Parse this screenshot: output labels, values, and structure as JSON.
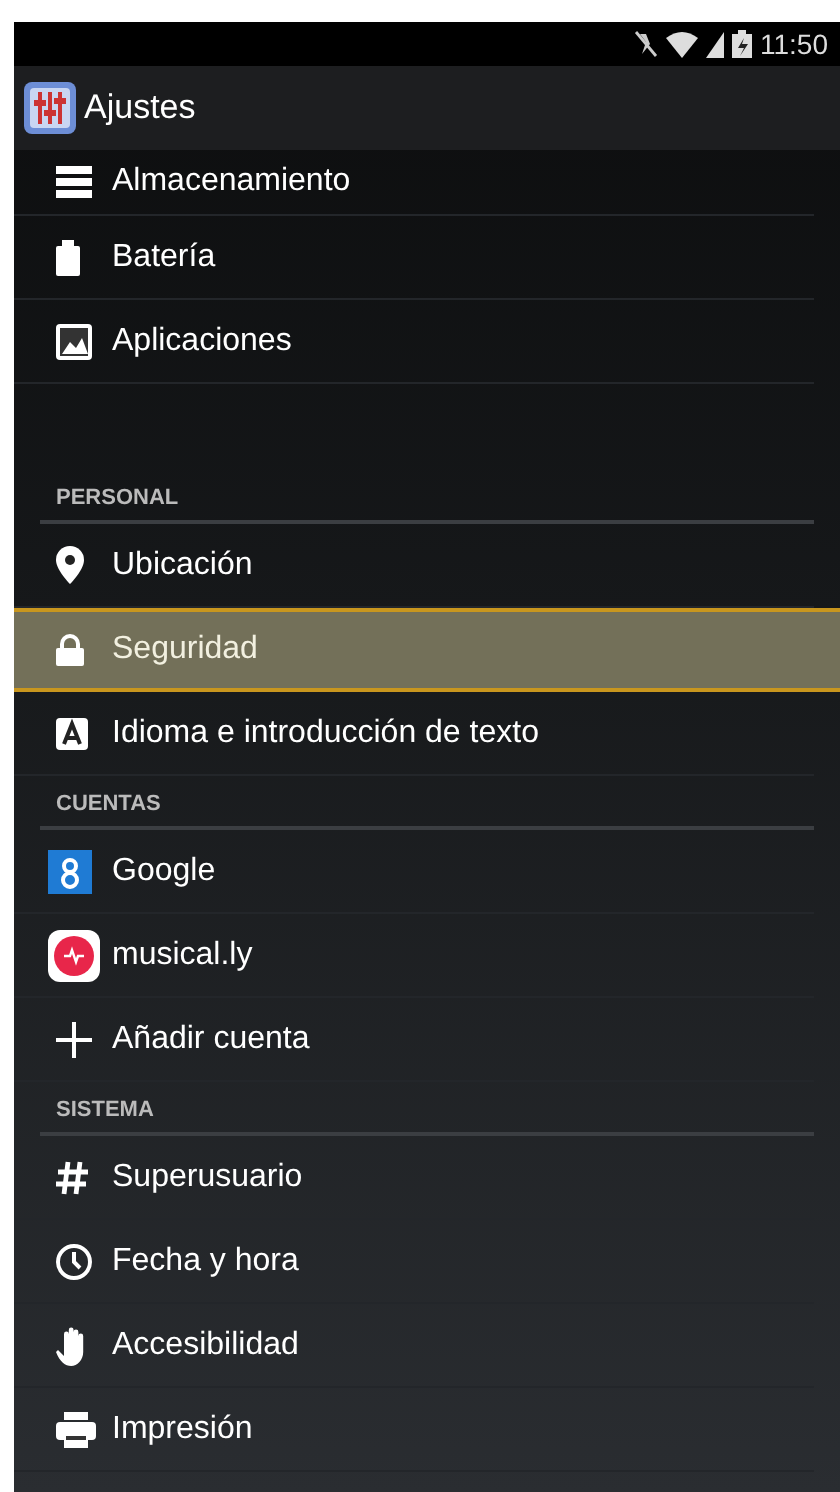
{
  "status_bar": {
    "time": "11:50"
  },
  "action_bar": {
    "title": "Ajustes"
  },
  "list": [
    {
      "kind": "item",
      "label": "Almacenamiento",
      "selected": false,
      "partial": true
    },
    {
      "kind": "item",
      "label": "Batería",
      "selected": false
    },
    {
      "kind": "item",
      "label": "Aplicaciones",
      "selected": false
    },
    {
      "kind": "spacer"
    },
    {
      "kind": "header",
      "label": "PERSONAL"
    },
    {
      "kind": "item",
      "label": "Ubicación",
      "selected": false
    },
    {
      "kind": "item",
      "label": "Seguridad",
      "selected": true
    },
    {
      "kind": "item",
      "label": "Idioma e introducción de texto",
      "selected": false
    },
    {
      "kind": "header",
      "label": "CUENTAS"
    },
    {
      "kind": "item",
      "label": "Google",
      "selected": false
    },
    {
      "kind": "item",
      "label": "musical.ly",
      "selected": false
    },
    {
      "kind": "item",
      "label": "Añadir cuenta",
      "selected": false
    },
    {
      "kind": "header",
      "label": "SISTEMA"
    },
    {
      "kind": "item",
      "label": "Superusuario",
      "selected": false
    },
    {
      "kind": "item",
      "label": "Fecha y hora",
      "selected": false
    },
    {
      "kind": "item",
      "label": "Accesibilidad",
      "selected": false
    },
    {
      "kind": "item",
      "label": "Impresión",
      "selected": false
    }
  ]
}
